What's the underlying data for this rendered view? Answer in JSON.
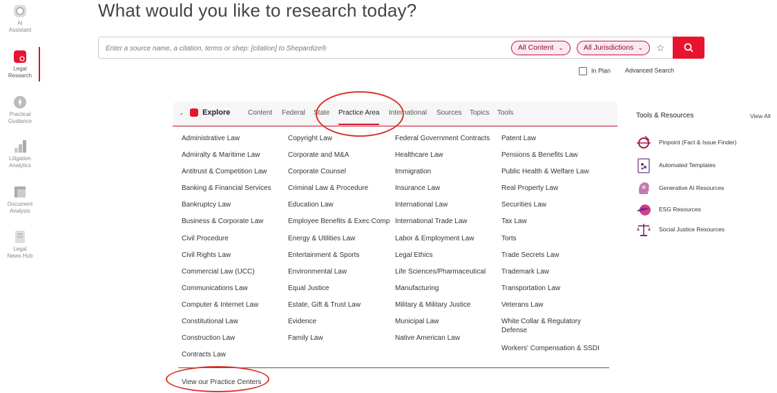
{
  "rail": {
    "items": [
      {
        "label1": "AI",
        "label2": "Assistant"
      },
      {
        "label1": "Legal",
        "label2": "Research"
      },
      {
        "label1": "Practical",
        "label2": "Guidance"
      },
      {
        "label1": "Litigation",
        "label2": "Analytics"
      },
      {
        "label1": "Document",
        "label2": "Analysis"
      },
      {
        "label1": "Legal",
        "label2": "News Hub"
      }
    ]
  },
  "heading": "What would you like to research today?",
  "search": {
    "placeholder": "Enter a source name, a citation, terms or shep: [citation] to Shepardize®",
    "content_filter": "All Content",
    "jurisdiction_filter": "All Jurisdictions",
    "in_plan_label": "In Plan",
    "advanced_label": "Advanced Search"
  },
  "explore": {
    "title": "Explore",
    "tabs": [
      "Content",
      "Federal",
      "State",
      "Practice Area",
      "International",
      "Sources",
      "Topics",
      "Tools"
    ],
    "active_tab": "Practice Area",
    "columns": [
      [
        "Administrative Law",
        "Admiralty & Maritime Law",
        "Antitrust & Competition Law",
        "Banking & Financial Services",
        "Bankruptcy Law",
        "Business & Corporate Law",
        "Civil Procedure",
        "Civil Rights Law",
        "Commercial Law (UCC)",
        "Communications Law",
        "Computer & Internet Law",
        "Constitutional Law",
        "Construction Law",
        "Contracts Law"
      ],
      [
        "Copyright Law",
        "Corporate and M&A",
        "Corporate Counsel",
        "Criminal Law & Procedure",
        "Education Law",
        "Employee Benefits & Exec Comp",
        "Energy & Utilities Law",
        "Entertainment & Sports",
        "Environmental Law",
        "Equal Justice",
        "Estate, Gift & Trust Law",
        "Evidence",
        "Family Law"
      ],
      [
        "Federal Government Contracts",
        "Healthcare Law",
        "Immigration",
        "Insurance Law",
        "International Law",
        "International Trade Law",
        "Labor & Employment Law",
        "Legal Ethics",
        "Life Sciences/Pharmaceutical",
        "Manufacturing",
        "Military & Military Justice",
        "Municipal Law",
        "Native American Law"
      ],
      [
        "Patent Law",
        "Pensions & Benefits Law",
        "Public Health & Welfare Law",
        "Real Property Law",
        "Securities Law",
        "Tax Law",
        "Torts",
        "Trade Secrets Law",
        "Trademark Law",
        "Transportation Law",
        "Veterans Law",
        "White Collar & Regulatory Defense",
        "Workers' Compensation & SSDI"
      ]
    ],
    "practice_centers_link": "View our Practice Centers"
  },
  "tools": {
    "title": "Tools & Resources",
    "view_all": "View All",
    "items": [
      {
        "label": "Pinpoint (Fact & Issue Finder)",
        "icon": "pinpoint-icon"
      },
      {
        "label": "Automated Templates",
        "icon": "templates-icon"
      },
      {
        "label": "Generative AI Resources",
        "icon": "ai-head-icon"
      },
      {
        "label": "ESG Resources",
        "icon": "esg-icon"
      },
      {
        "label": "Social Justice Resources",
        "icon": "scales-icon"
      }
    ]
  },
  "colors": {
    "accent": "#e8142f",
    "pill_border": "#c0123a",
    "annotation": "#d9342b"
  }
}
